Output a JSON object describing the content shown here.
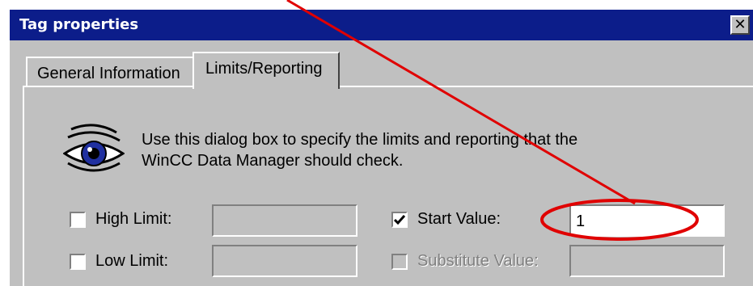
{
  "window": {
    "title": "Tag properties",
    "close_glyph": "✕"
  },
  "tabs": [
    {
      "label": "General Information",
      "active": false
    },
    {
      "label": "Limits/Reporting",
      "active": true
    }
  ],
  "description": {
    "line1": "Use this dialog box to specify the limits and reporting that the",
    "line2": "WinCC Data Manager should check.",
    "icon": "eye-icon"
  },
  "fields": {
    "high_limit": {
      "label": "High Limit:",
      "checked": false,
      "value": ""
    },
    "low_limit": {
      "label": "Low Limit:",
      "checked": false,
      "value": ""
    },
    "start_value": {
      "label": "Start Value:",
      "checked": true,
      "value": "1"
    },
    "substitute_value": {
      "label": "Substitute Value:",
      "checked": false,
      "enabled": false,
      "value": ""
    }
  },
  "colors": {
    "titlebar": "#0c1d8a",
    "annotation": "#e00000",
    "face": "#c0c0c0"
  }
}
